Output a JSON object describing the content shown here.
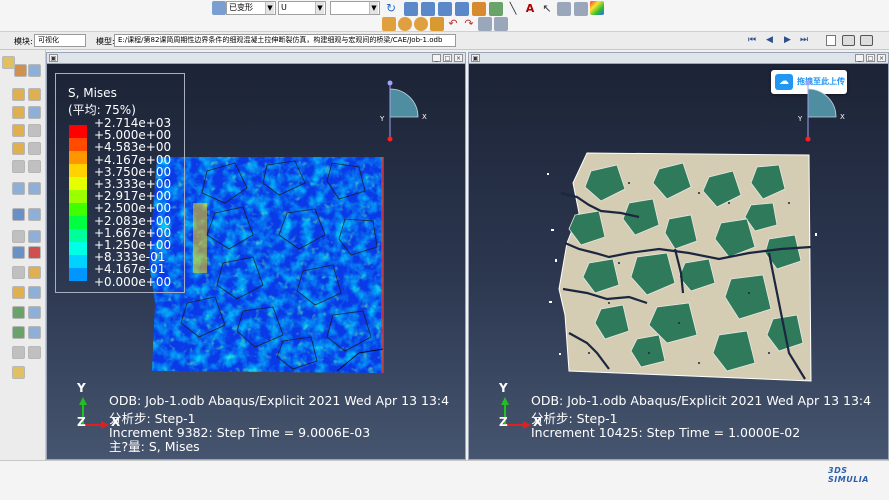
{
  "toolbar": {
    "deform_select": "已变形",
    "field_select": "U",
    "blank_select": ""
  },
  "module_bar": {
    "module_label": "模块:",
    "module_value": "可视化",
    "model_label": "模型:",
    "model_value": "E:/课程/第82课简周期性边界条件的细观混凝土拉伸断裂仿真，构建细观与宏观间的桥梁/CAE/Job-1.odb"
  },
  "left_viewport": {
    "legend": {
      "title": "S, Mises",
      "average": "(平均: 75%)",
      "values": [
        "+2.714e+03",
        "+5.000e+00",
        "+4.583e+00",
        "+4.167e+00",
        "+3.750e+00",
        "+3.333e+00",
        "+2.917e+00",
        "+2.500e+00",
        "+2.083e+00",
        "+1.667e+00",
        "+1.250e+00",
        "+8.333e-01",
        "+4.167e-01",
        "+0.000e+00"
      ],
      "colors": [
        "#ff0000",
        "#ff4a00",
        "#ff9600",
        "#ffd200",
        "#e6ff00",
        "#9cff00",
        "#40ff00",
        "#00ff40",
        "#00ff9c",
        "#00ffe6",
        "#00d2ff",
        "#0096ff",
        "#004aff",
        "#0000ff"
      ]
    },
    "odb_line": "ODB: Job-1.odb    Abaqus/Explicit 2021    Wed Apr 13 13:4",
    "step_line": "分析步: Step-1",
    "increment_line": "Increment      9382: Step Time =    9.0006E-03",
    "primary_line": "主?量: S, Mises",
    "axis_y": "Y",
    "axis_x": "X",
    "axis_z": "Z"
  },
  "right_viewport": {
    "upload_badge": "拖拽至此上传",
    "odb_line": "ODB: Job-1.odb    Abaqus/Explicit 2021    Wed Apr 13 13:4",
    "step_line": "分析步: Step-1",
    "increment_line": "Increment     10425: Step Time =    1.0000E-02",
    "axis_y": "Y",
    "axis_x": "X",
    "axis_z": "Z"
  },
  "triad": {
    "y_label": "Y",
    "x_label": "X"
  },
  "brand": "3DS SIMULIA"
}
